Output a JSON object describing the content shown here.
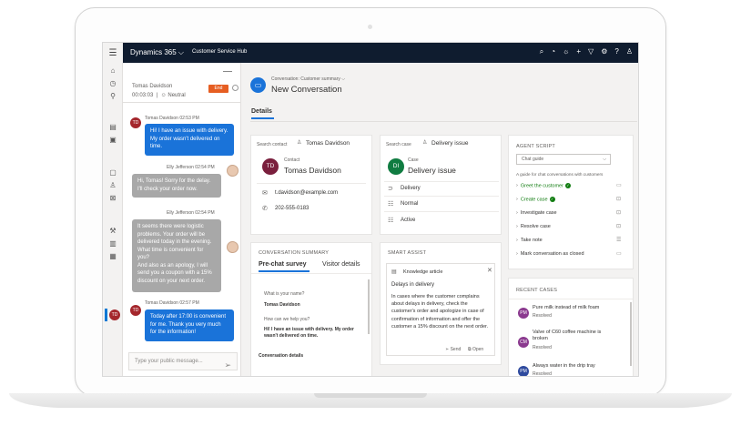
{
  "app": {
    "title": "Dynamics 365",
    "hub": "Customer Service Hub"
  },
  "chat": {
    "customer_name": "Tomas Davidson",
    "timer": "00:03:03",
    "sentiment": "Neutral",
    "end_label": "End",
    "messages": [
      {
        "sender": "Tomas Davidson 02:53 PM",
        "initials": "TD",
        "text": "Hi! I have an issue with delivery. My order wasn't delivered on time."
      },
      {
        "sender": "Elly Jefferson 02:54 PM",
        "text": "Hi, Tomas! Sorry for the delay. I'll check your order now."
      },
      {
        "sender": "Elly Jefferson 02:54 PM",
        "text": "It seems there were logistic problems. Your order will be delivered today in the evening. What time is convenient for you?\nAnd also as an apology, I will send you a coupon with a 15% discount on your next order."
      },
      {
        "sender": "Tomas Davidson 02:57 PM",
        "initials": "TD",
        "text": "Today after 17:00 is convenient for me. Thank you very much for the information!"
      }
    ],
    "input_placeholder": "Type your public message...",
    "rail_badge": "TD"
  },
  "conversation": {
    "subtitle": "Conversation: Customer summary",
    "title": "New Conversation",
    "tab": "Details"
  },
  "contact_card": {
    "search_label": "Search contact",
    "search_value": "Tomas Davidson",
    "initials": "TD",
    "type_label": "Contact",
    "name": "Tomas Davidson",
    "email": "t.davidson@example.com",
    "phone": "202-555-0183"
  },
  "case_card": {
    "search_label": "Search case",
    "search_value": "Delivery issue",
    "initials": "DI",
    "type_label": "Case",
    "name": "Delivery issue",
    "category": "Delivery",
    "priority": "Normal",
    "status": "Active"
  },
  "agent_script": {
    "title": "AGENT SCRIPT",
    "dropdown": "Chat guide",
    "description": "A guide for chat conversations with customers",
    "steps": [
      {
        "label": "Greet the customer",
        "done": true
      },
      {
        "label": "Create case",
        "done": true
      },
      {
        "label": "Investigate case",
        "done": false
      },
      {
        "label": "Resolve case",
        "done": false
      },
      {
        "label": "Take note",
        "done": false
      },
      {
        "label": "Mark conversation as closed",
        "done": false
      }
    ]
  },
  "summary": {
    "title": "CONVERSATION SUMMARY",
    "tabs": [
      "Pre-chat survey",
      "Visitor details"
    ],
    "q1": "What is your name?",
    "a1": "Tomas Davidson",
    "q2": "How can we help you?",
    "a2": "Hi! I have an issue with delivery. My order wasn't delivered on time.",
    "section": "Conversation details"
  },
  "smart_assist": {
    "title": "SMART ASSIST",
    "kind": "Knowledge article",
    "article_title": "Delays in delivery",
    "article_text": "In cases where the customer complains about delays in delivery, check the customer's order and apologize in case of confirmation of information and offer the customer a 15% discount on the next order.",
    "send": "Send",
    "open": "Open"
  },
  "recent_cases": {
    "title": "RECENT CASES",
    "items": [
      {
        "initials": "PM",
        "title": "Pure milk instead of milk foam",
        "status": "Resolved",
        "color": "#8b3a8f"
      },
      {
        "initials": "CM",
        "title": "Valve of C60 coffee machine is broken",
        "status": "Resolved",
        "color": "#8b3a8f"
      },
      {
        "initials": "PM",
        "title": "Always water in the drip tray",
        "status": "Resolved",
        "color": "#2e4a9e"
      }
    ]
  },
  "colors": {
    "accent": "#1a73d9",
    "topbar": "#0f1c2f",
    "end": "#e65e22",
    "success": "#107c10"
  }
}
